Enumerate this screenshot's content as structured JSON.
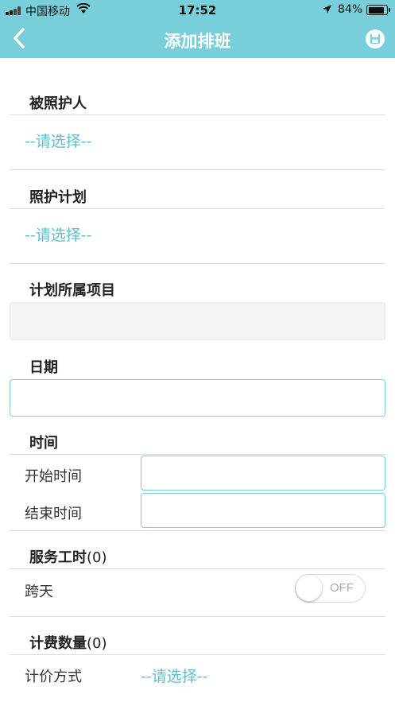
{
  "status_bar": {
    "carrier": "中国移动",
    "time": "17:52",
    "battery_percent": "84%"
  },
  "nav": {
    "title": "添加排班",
    "back_icon": "chevron-left-icon",
    "save_icon": "save-floppy-icon"
  },
  "form": {
    "care_recipient": {
      "label": "被照护人",
      "placeholder": "--请选择--"
    },
    "care_plan": {
      "label": "照护计划",
      "placeholder": "--请选择--"
    },
    "plan_project": {
      "label": "计划所属项目",
      "value": ""
    },
    "date": {
      "label": "日期",
      "value": ""
    },
    "time": {
      "label": "时间",
      "start_label": "开始时间",
      "start_value": "",
      "end_label": "结束时间",
      "end_value": ""
    },
    "service_hours": {
      "label": "服务工时",
      "count": "(0)"
    },
    "cross_day": {
      "label": "跨天",
      "toggle_text": "OFF",
      "on": false
    },
    "billing_quantity": {
      "label": "计费数量",
      "count": "(0)"
    },
    "pricing_method": {
      "label": "计价方式",
      "placeholder": "--请选择--"
    }
  },
  "colors": {
    "header": "#79cfd9",
    "accent": "#5ec0cc",
    "input_border": "#7bcfd8"
  }
}
